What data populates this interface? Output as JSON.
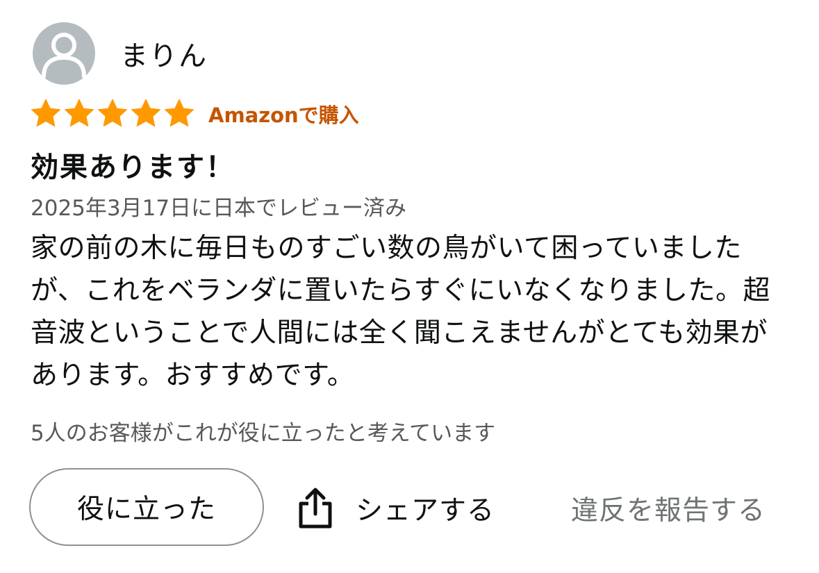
{
  "reviewer": {
    "name": "まりん",
    "avatar_icon": "default-user-avatar-icon"
  },
  "rating": {
    "stars": 5,
    "max_stars": 5,
    "star_color": "#ff9900",
    "verified_label": "Amazonで購入",
    "verified_color": "#c45500"
  },
  "review": {
    "title": "効果あります！",
    "date_text": "2025年3月17日に日本でレビュー済み",
    "body": "家の前の木に毎日ものすごい数の鳥がいて困っていましたが、これをベランダに置いたらすぐにいなくなりました。超音波ということで人間には全く聞こえませんがとても効果があります。おすすめです。",
    "helpful_count_text": "5人のお客様がこれが役に立ったと考えています"
  },
  "actions": {
    "helpful_label": "役に立った",
    "share_label": "シェアする",
    "share_icon": "share-upload-icon",
    "report_label": "違反を報告する"
  }
}
